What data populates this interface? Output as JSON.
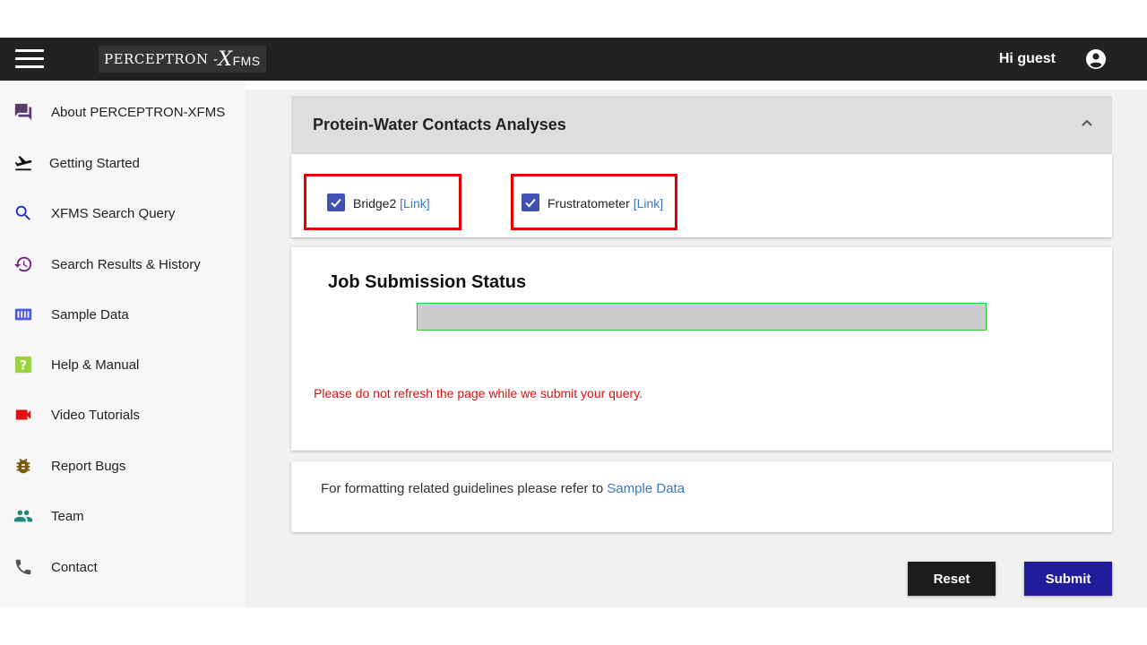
{
  "header": {
    "logo_main": "PERCEPTRON -",
    "logo_x": "X",
    "logo_sub": "FMS",
    "greeting": "Hi guest"
  },
  "sidebar": {
    "items": [
      {
        "label": "About PERCEPTRON-XFMS",
        "icon": "forum-icon",
        "color": "#5b3b6e"
      },
      {
        "label": "Getting Started",
        "icon": "flight-takeoff-icon",
        "color": "#111111"
      },
      {
        "label": "XFMS Search Query",
        "icon": "search-icon",
        "color": "#1a2db5"
      },
      {
        "label": "Search Results & History",
        "icon": "history-icon",
        "color": "#7a1f8a"
      },
      {
        "label": "Sample Data",
        "icon": "view-column-icon",
        "color": "#4a5ae8"
      },
      {
        "label": "Help & Manual",
        "icon": "help-icon",
        "color": "#9ad43a"
      },
      {
        "label": "Video Tutorials",
        "icon": "videocam-icon",
        "color": "#e01010"
      },
      {
        "label": "Report Bugs",
        "icon": "bug-icon",
        "color": "#7a5a10"
      },
      {
        "label": "Team",
        "icon": "people-icon",
        "color": "#1f8a7a"
      },
      {
        "label": "Contact",
        "icon": "phone-icon",
        "color": "#555555"
      }
    ]
  },
  "analysis_panel": {
    "title": "Protein-Water Contacts Analyses",
    "options": [
      {
        "name": "Bridge2",
        "link": "[Link]",
        "checked": true
      },
      {
        "name": "Frustratometer",
        "link": "[Link]",
        "checked": true
      }
    ]
  },
  "status_panel": {
    "title": "Job Submission Status",
    "progress": 0,
    "warning": "Please do not refresh the page while we submit your query."
  },
  "guide_panel": {
    "text": "For formatting related guidelines please refer to",
    "link": "Sample Data"
  },
  "buttons": {
    "reset": "Reset",
    "submit": "Submit"
  },
  "colors": {
    "accent": "#3f51b5",
    "highlight": "#e00000",
    "submit": "#201c9a",
    "link": "#3a78c7"
  }
}
